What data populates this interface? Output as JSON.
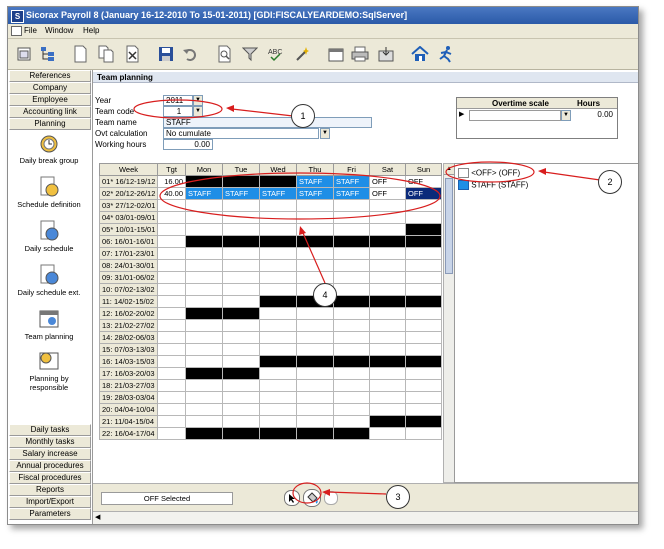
{
  "window": {
    "title": "Sicorax Payroll 8 (January 16-12-2010 To 15-01-2011) [GDI:FISCALYEARDEMO:SqlServer]",
    "app_icon": "S"
  },
  "menu": [
    "File",
    "Window",
    "Help"
  ],
  "toolbar_icons": [
    "restore-icon",
    "tree-icon",
    "document-icon",
    "copy-icon",
    "delete-icon",
    "save-icon",
    "undo-icon",
    "print-preview-icon",
    "filter-icon",
    "spell-check-icon",
    "wand-icon",
    "calendar-icon",
    "print-icon",
    "export-icon",
    "home-icon",
    "run-icon"
  ],
  "sidebar": {
    "top_buttons": [
      "References",
      "Company",
      "Employee",
      "Accounting link",
      "Planning"
    ],
    "items": [
      "Daily break group",
      "Schedule definition",
      "Daily schedule",
      "Daily schedule ext.",
      "Team planning",
      "Planning by responsible"
    ],
    "bottom_buttons": [
      "Daily tasks",
      "Monthly tasks",
      "Salary increase",
      "Annual procedures",
      "Fiscal procedures",
      "Reports",
      "Import/Export",
      "Parameters"
    ]
  },
  "panel": {
    "title": "Team planning",
    "fields": {
      "year_label": "Year",
      "year_value": "2011",
      "team_code_label": "Team code",
      "team_code_value": "1",
      "team_name_label": "Team name",
      "team_name_value": "STAFF",
      "ovt_label": "Ovt calculation",
      "ovt_value": "No cumulate",
      "hours_label": "Working hours",
      "hours_value": "0.00"
    },
    "overtime": {
      "scale_label": "Overtime scale",
      "hours_label": "Hours",
      "hours_value": "0.00"
    },
    "grid": {
      "headers": [
        "Week",
        "Tgt",
        "Mon",
        "Tue",
        "Wed",
        "Thu",
        "Fri",
        "Sat",
        "Sun"
      ],
      "rows": [
        {
          "week": "01* 16/12-19/12",
          "tgt": "16.00",
          "cells": [
            "B",
            "B",
            "B",
            "STAFF",
            "STAFF",
            "OFF",
            "OFF"
          ]
        },
        {
          "week": "02* 20/12-26/12",
          "tgt": "40.00",
          "cells": [
            "STAFF",
            "STAFF",
            "STAFF",
            "STAFF",
            "STAFF",
            "OFF",
            "OFF*"
          ]
        },
        {
          "week": "03* 27/12-02/01",
          "tgt": "",
          "cells": [
            "",
            "",
            "",
            "",
            "",
            "",
            ""
          ]
        },
        {
          "week": "04* 03/01-09/01",
          "tgt": "",
          "cells": [
            "",
            "",
            "",
            "",
            "",
            "",
            ""
          ]
        },
        {
          "week": "05* 10/01-15/01",
          "tgt": "",
          "cells": [
            "",
            "",
            "",
            "",
            "",
            "",
            "B"
          ]
        },
        {
          "week": "06: 16/01-16/01",
          "tgt": "",
          "cells": [
            "B",
            "B",
            "B",
            "B",
            "B",
            "B",
            "B"
          ]
        },
        {
          "week": "07: 17/01-23/01",
          "tgt": "",
          "cells": [
            "",
            "",
            "",
            "",
            "",
            "",
            ""
          ]
        },
        {
          "week": "08: 24/01-30/01",
          "tgt": "",
          "cells": [
            "",
            "",
            "",
            "",
            "",
            "",
            ""
          ]
        },
        {
          "week": "09: 31/01-06/02",
          "tgt": "",
          "cells": [
            "",
            "",
            "",
            "",
            "",
            "",
            ""
          ]
        },
        {
          "week": "10: 07/02-13/02",
          "tgt": "",
          "cells": [
            "",
            "",
            "",
            "",
            "",
            "",
            ""
          ]
        },
        {
          "week": "11: 14/02-15/02",
          "tgt": "",
          "cells": [
            "",
            "",
            "B",
            "B",
            "B",
            "B",
            "B"
          ]
        },
        {
          "week": "12: 16/02-20/02",
          "tgt": "",
          "cells": [
            "B",
            "B",
            "",
            "",
            "",
            "",
            ""
          ]
        },
        {
          "week": "13: 21/02-27/02",
          "tgt": "",
          "cells": [
            "",
            "",
            "",
            "",
            "",
            "",
            ""
          ]
        },
        {
          "week": "14: 28/02-06/03",
          "tgt": "",
          "cells": [
            "",
            "",
            "",
            "",
            "",
            "",
            ""
          ]
        },
        {
          "week": "15: 07/03-13/03",
          "tgt": "",
          "cells": [
            "",
            "",
            "",
            "",
            "",
            "",
            ""
          ]
        },
        {
          "week": "16: 14/03-15/03",
          "tgt": "",
          "cells": [
            "",
            "",
            "B",
            "B",
            "B",
            "B",
            "B"
          ]
        },
        {
          "week": "17: 16/03-20/03",
          "tgt": "",
          "cells": [
            "B",
            "B",
            "",
            "",
            "",
            "",
            ""
          ]
        },
        {
          "week": "18: 21/03-27/03",
          "tgt": "",
          "cells": [
            "",
            "",
            "",
            "",
            "",
            "",
            ""
          ]
        },
        {
          "week": "19: 28/03-03/04",
          "tgt": "",
          "cells": [
            "",
            "",
            "",
            "",
            "",
            "",
            ""
          ]
        },
        {
          "week": "20: 04/04-10/04",
          "tgt": "",
          "cells": [
            "",
            "",
            "",
            "",
            "",
            "",
            ""
          ]
        },
        {
          "week": "21: 11/04-15/04",
          "tgt": "",
          "cells": [
            "",
            "",
            "",
            "",
            "",
            "B",
            "B"
          ]
        },
        {
          "week": "22: 16/04-17/04",
          "tgt": "",
          "cells": [
            "B",
            "B",
            "B",
            "B",
            "B",
            "",
            ""
          ]
        }
      ]
    },
    "schedules": [
      {
        "label": "<OFF> (OFF)",
        "color": "#ffffff"
      },
      {
        "label": "STAFF (STAFF)",
        "color": "#1e8ee6"
      }
    ],
    "status_text": "OFF Selected"
  },
  "callouts": [
    "1",
    "2",
    "3",
    "4"
  ],
  "colors": {
    "schedule_blue": "#1e8ee6",
    "annotation_red": "#d81e1e",
    "block": "#000000"
  }
}
